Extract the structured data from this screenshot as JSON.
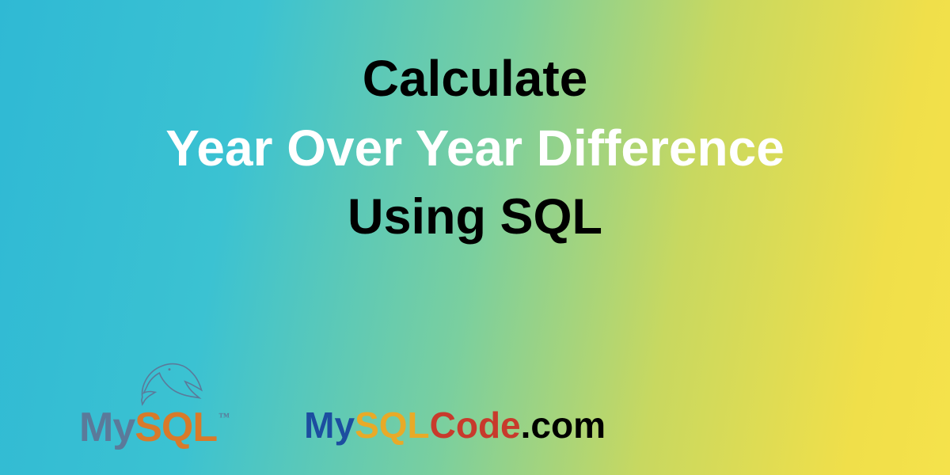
{
  "title": {
    "line1": "Calculate",
    "line2": "Year Over Year Difference",
    "line3": "Using SQL"
  },
  "mysql_logo": {
    "my": "My",
    "sql": "SQL",
    "tm": "™"
  },
  "site_logo": {
    "my": "My",
    "sql": "SQL",
    "code": "Code",
    "dot": ".",
    "com": "com"
  },
  "colors": {
    "gradient_start": "#2fb9d4",
    "gradient_end": "#f5e24b",
    "title_black": "#000000",
    "title_white": "#ffffff",
    "mysql_my": "#5b7a9a",
    "mysql_sql": "#d87a2a",
    "site_my": "#1c4ea0",
    "site_sql": "#e8aa28",
    "site_code": "#c83a2c",
    "site_com": "#000000"
  }
}
